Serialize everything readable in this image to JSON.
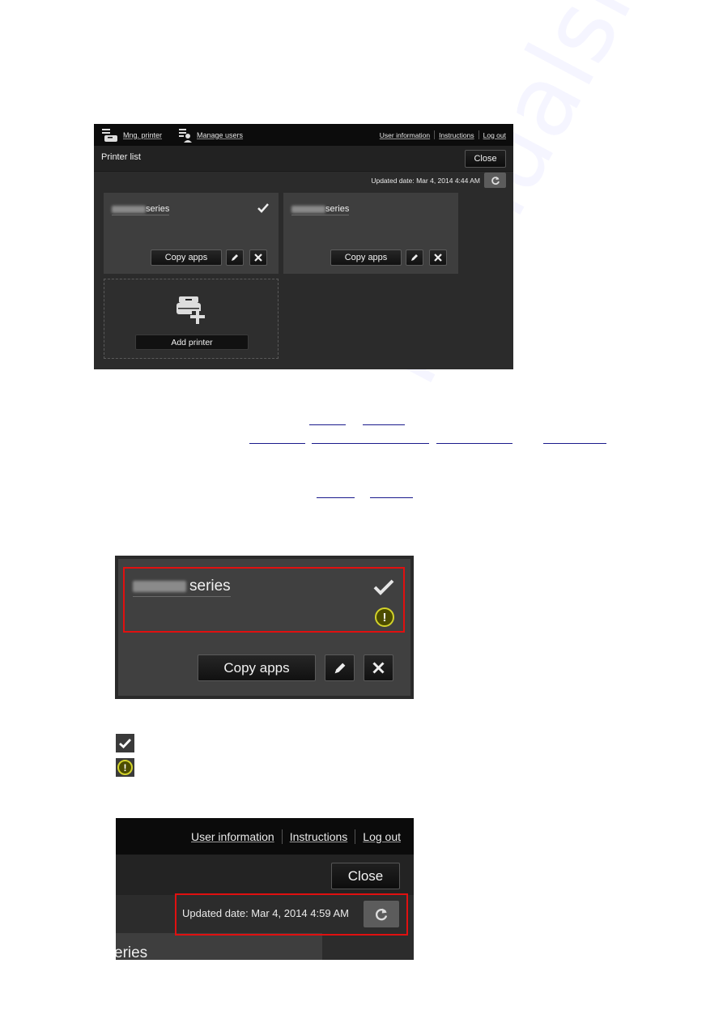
{
  "screenshot_1": {
    "nav": {
      "mng_printer": "Mng. printer",
      "manage_users": "Manage users",
      "user_information": "User information",
      "instructions": "Instructions",
      "log_out": "Log out"
    },
    "title": "Printer list",
    "close_label": "Close",
    "updated_date": "Updated date: Mar 4, 2014 4:44 AM",
    "printers": [
      {
        "name_suffix": "series",
        "selected": true,
        "copy_apps_label": "Copy apps"
      },
      {
        "name_suffix": "series",
        "selected": false,
        "copy_apps_label": "Copy apps"
      }
    ],
    "add_printer_label": "Add printer"
  },
  "doc_links": {
    "row1": [
      "",
      ""
    ],
    "row2": [
      "",
      "",
      "",
      ""
    ],
    "row3": [
      "",
      ""
    ]
  },
  "screenshot_2": {
    "printer_name_suffix": "series",
    "copy_apps_label": "Copy apps",
    "status_icons": [
      "check-icon",
      "warning-icon"
    ]
  },
  "legend_icons": [
    "check-icon",
    "warning-icon"
  ],
  "screenshot_3": {
    "user_information": "User information",
    "instructions": "Instructions",
    "log_out": "Log out",
    "close_label": "Close",
    "updated_date": "Updated date: Mar 4, 2014 4:59 AM",
    "partial_card_text": "eries"
  },
  "colors": {
    "highlight_red": "#e01010",
    "warning_yellow": "#d2d22a",
    "link_blue": "#1a1a8c"
  }
}
